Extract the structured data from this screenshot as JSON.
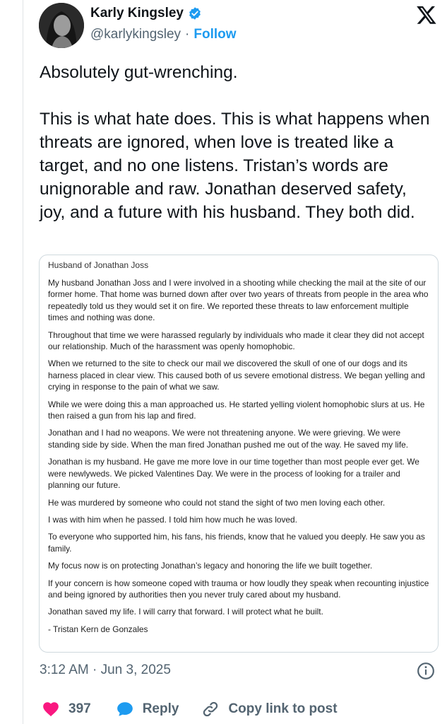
{
  "author": {
    "display_name": "Karly Kingsley",
    "handle": "@karlykingsley",
    "separator": "·",
    "follow_label": "Follow"
  },
  "tweet": {
    "text": "Absolutely gut-wrenching.\n\nThis is what hate does. This is what happens when threats are ignored, when love is treated like a target, and no one listens. Tristan’s words are unignorable and raw. Jonathan deserved safety, joy, and a future with his husband. They both did."
  },
  "statement": {
    "header": "Husband of Jonathan Joss",
    "paragraphs": [
      "My husband Jonathan Joss and I were involved in a shooting while checking the mail at the site of our former home. That home was burned down after over two years of threats from people in the area who repeatedly told us they would set it on fire. We reported these threats to law enforcement multiple times and nothing was done.",
      "Throughout that time we were harassed regularly by individuals who made it clear they did not accept our relationship. Much of the harassment was openly homophobic.",
      "When we returned to the site to check our mail we discovered the skull of one of our dogs and its harness placed in clear view. This caused both of us severe emotional distress. We began yelling and crying in response to the pain of what we saw.",
      "While we were doing this a man approached us. He started yelling violent homophobic slurs at us. He then raised a gun from his lap and fired.",
      "Jonathan and I had no weapons. We were not threatening anyone. We were grieving. We were standing side by side. When the man fired Jonathan pushed me out of the way. He saved my life.",
      "Jonathan is my husband. He gave me more love in our time together than most people ever get. We were newlyweds. We picked Valentines Day. We were in the process of looking for a trailer and planning our future.",
      "He was murdered by someone who could not stand the sight of two men loving each other.",
      "I was with him when he passed. I told him how much he was loved.",
      "To everyone who supported him, his fans, his friends, know that he valued you deeply. He saw you as family.",
      "My focus now is on protecting Jonathan’s legacy and honoring the life we built together.",
      "If your concern is how someone coped with trauma or how loudly they speak when recounting injustice and being ignored by authorities then you never truly cared about my husband.",
      "Jonathan saved my life. I will carry that forward. I will protect what he built.",
      "- Tristan Kern de Gonzales"
    ]
  },
  "meta": {
    "timestamp": "3:12 AM · Jun 3, 2025"
  },
  "actions": {
    "like_count": "397",
    "reply_label": "Reply",
    "copy_link_label": "Copy link to post"
  },
  "colors": {
    "accent": "#1d9bf0",
    "like": "#f91880",
    "muted": "#536471"
  }
}
